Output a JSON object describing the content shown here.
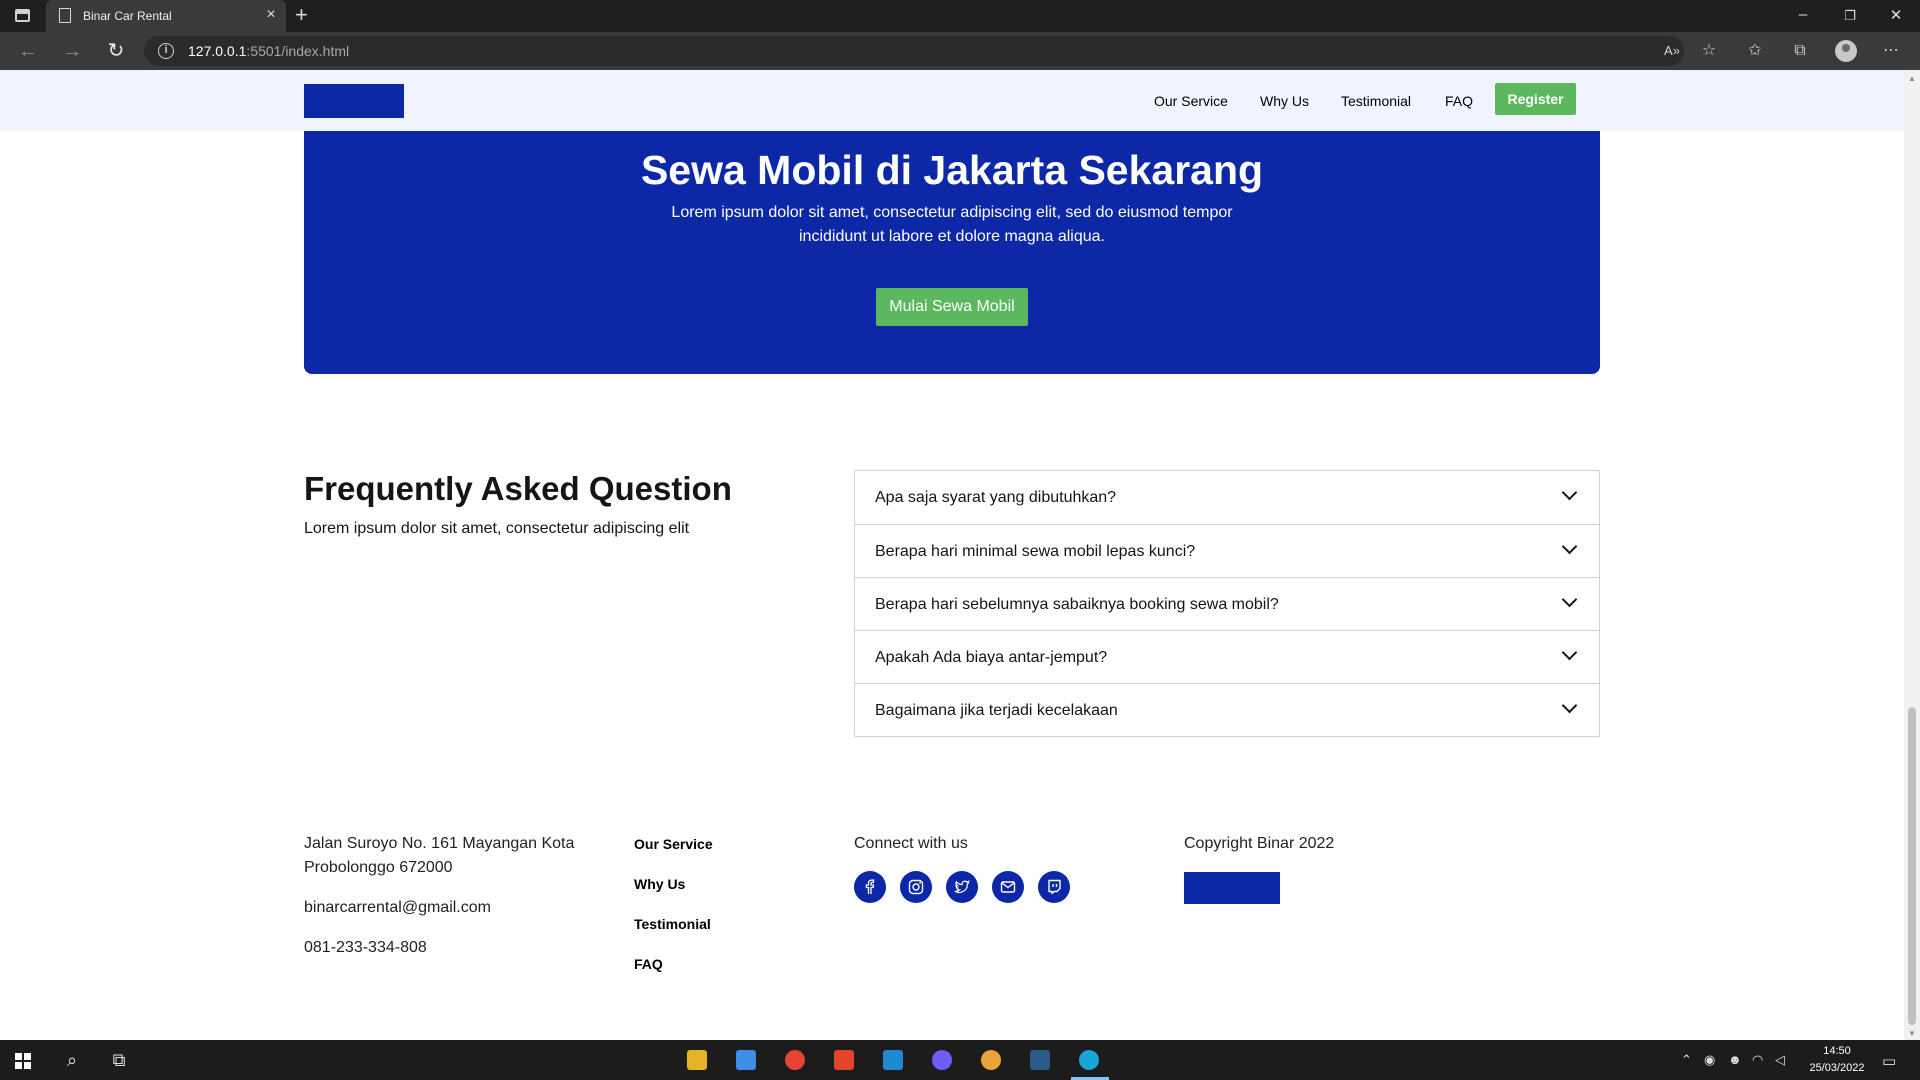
{
  "browser": {
    "tab_title": "Binar Car Rental",
    "tab_close": "×",
    "new_tab": "+",
    "url_host": "127.0.0.1",
    "url_path": ":5501/index.html",
    "window_controls": {
      "minimize": "–",
      "restore": "❐",
      "close": "✕"
    }
  },
  "nav": {
    "links": [
      "Our Service",
      "Why Us",
      "Testimonial",
      "FAQ"
    ],
    "register": "Register"
  },
  "cta": {
    "title": "Sewa Mobil di Jakarta Sekarang",
    "description": "Lorem ipsum dolor sit amet, consectetur adipiscing elit, sed do eiusmod tempor incididunt ut labore et dolore magna aliqua.",
    "button": "Mulai Sewa Mobil"
  },
  "faq": {
    "title": "Frequently Asked Question",
    "subtitle": "Lorem ipsum dolor sit amet, consectetur adipiscing elit",
    "questions": [
      "Apa saja syarat yang dibutuhkan?",
      "Berapa hari minimal sewa mobil lepas kunci?",
      "Berapa hari sebelumnya sabaiknya booking sewa mobil?",
      "Apakah Ada biaya antar-jemput?",
      "Bagaimana jika terjadi kecelakaan"
    ]
  },
  "footer": {
    "address_line1": "Jalan Suroyo No. 161 Mayangan Kota",
    "address_line2": "Probolonggo 672000",
    "email": "binarcarrental@gmail.com",
    "phone": "081-233-334-808",
    "links": [
      "Our Service",
      "Why Us",
      "Testimonial",
      "FAQ"
    ],
    "connect": "Connect with us",
    "social": [
      "facebook-icon",
      "instagram-icon",
      "twitter-icon",
      "mail-icon",
      "twitch-icon"
    ],
    "copyright": "Copyright Binar 2022"
  },
  "taskbar": {
    "time": "14:50",
    "date": "25/03/2022"
  },
  "colors": {
    "brand_blue": "#0d28a6",
    "green": "#5cb85f",
    "nav_bg": "#f1f3ff"
  }
}
